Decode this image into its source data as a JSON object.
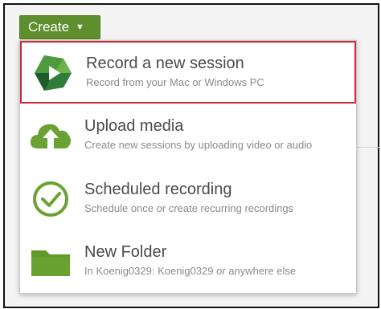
{
  "create_button": {
    "label": "Create",
    "caret_icon": "caret-down-icon"
  },
  "menu": {
    "items": [
      {
        "title": "Record a new session",
        "description": "Record from your Mac or Windows PC",
        "icon": "panopto-record-icon",
        "selected": true
      },
      {
        "title": "Upload media",
        "description": "Create new sessions by uploading video or audio",
        "icon": "cloud-upload-icon"
      },
      {
        "title": "Scheduled recording",
        "description": "Schedule once or create recurring recordings",
        "icon": "clock-check-icon"
      },
      {
        "title": "New Folder",
        "description": "In Koenig0329: Koenig0329 or anywhere else",
        "icon": "folder-icon"
      }
    ]
  },
  "colors": {
    "accent_green": "#5f8e2e",
    "selection_red": "#cc2b36",
    "icon_green": "#6aa232"
  }
}
